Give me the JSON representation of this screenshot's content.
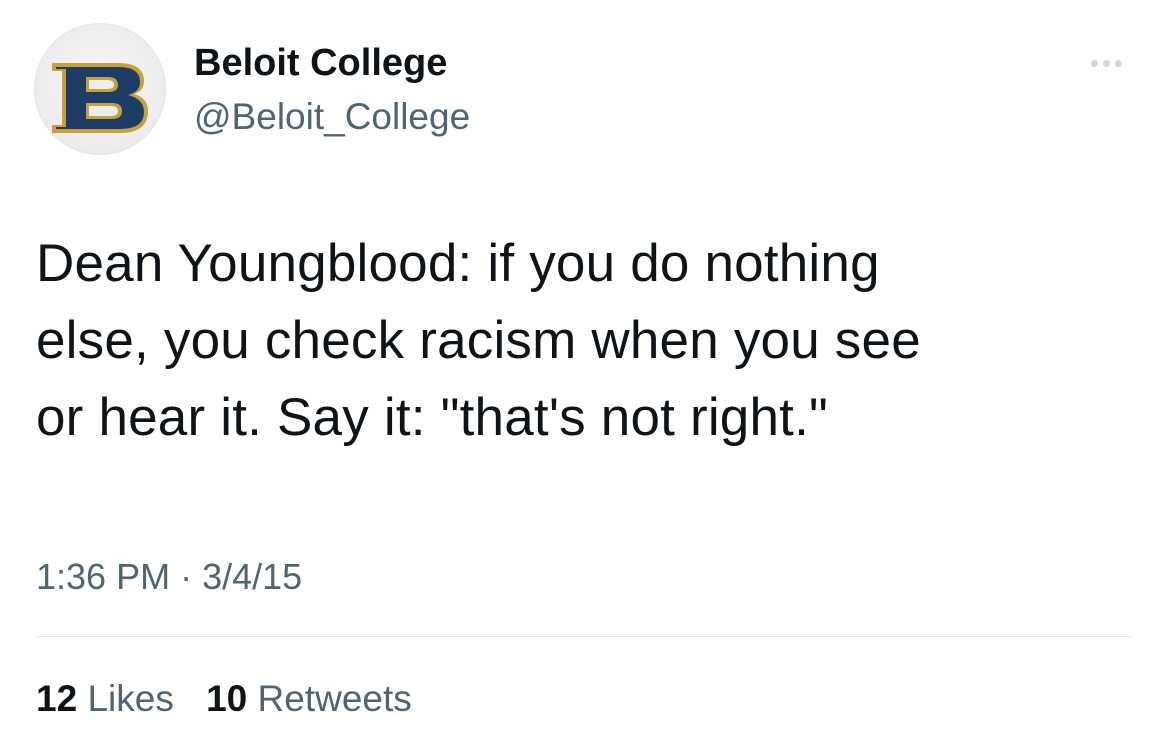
{
  "account": {
    "display_name": "Beloit College",
    "handle": "@Beloit_College",
    "avatar_icon": "beloit-b-logo-icon",
    "avatar_letter": "B",
    "avatar_colors": {
      "letter_fill": "#1d3d66",
      "letter_outline": "#c9a13b",
      "background": "#efefef"
    }
  },
  "tweet": {
    "text_lines": [
      "Dean Youngblood: if you do nothing",
      "else, you check racism when you see",
      "or hear it. Say it: \"that's not right.\""
    ]
  },
  "meta": {
    "time": "1:36 PM",
    "separator": "·",
    "date": "3/4/15"
  },
  "stats": {
    "likes_count": "12",
    "likes_label": "Likes",
    "retweets_count": "10",
    "retweets_label": "Retweets"
  },
  "more_icon": "more-options-icon",
  "colors": {
    "primary_text": "#0f1419",
    "secondary_text": "#536471",
    "divider": "#e1e6ea"
  }
}
